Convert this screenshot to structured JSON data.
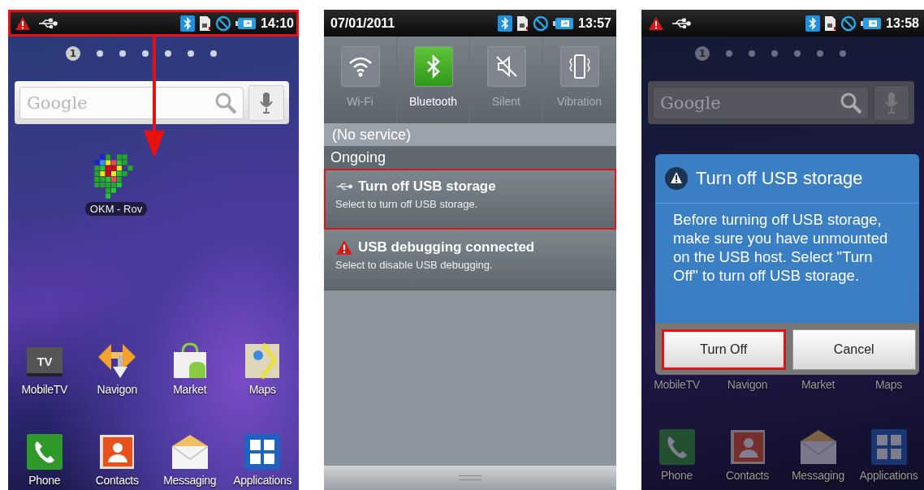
{
  "screens": [
    {
      "kind": "home",
      "status_bar": {
        "time": "14:10",
        "highlighted": true
      },
      "pull_down_arrow": true,
      "page_dots": [
        {
          "label": "1",
          "selected": true
        },
        {
          "selected": false
        },
        {
          "selected": false
        },
        {
          "selected": false
        },
        {
          "selected": false
        },
        {
          "selected": false
        },
        {
          "selected": false
        }
      ],
      "search": {
        "placeholder": "Google"
      },
      "shortcut": {
        "label": "OKM - Rov"
      },
      "apps": [
        {
          "kind": "tv",
          "label": "MobileTV",
          "icon_text": "TV"
        },
        {
          "kind": "navigation",
          "label": "Navigon"
        },
        {
          "kind": "market",
          "label": "Market"
        },
        {
          "kind": "maps",
          "label": "Maps"
        }
      ],
      "dock": [
        {
          "kind": "phone",
          "label": "Phone"
        },
        {
          "kind": "contacts",
          "label": "Contacts"
        },
        {
          "kind": "messaging",
          "label": "Messaging"
        },
        {
          "kind": "grid",
          "label": "Applications"
        }
      ]
    },
    {
      "kind": "notifications",
      "status_bar": {
        "date": "07/01/2011",
        "time": "13:57",
        "highlighted": false
      },
      "toggles": [
        {
          "kind": "wifi",
          "label": "Wi-Fi",
          "on": false
        },
        {
          "kind": "bluetooth",
          "label": "Bluetooth",
          "on": true
        },
        {
          "kind": "silent",
          "label": "Silent",
          "on": false
        },
        {
          "kind": "vibration",
          "label": "Vibration",
          "on": false
        }
      ],
      "carrier": "(No service)",
      "section": "Ongoing",
      "notifications": [
        {
          "kind": "usb",
          "title": "Turn off USB storage",
          "text": "Select to turn off USB storage.",
          "highlighted": true
        },
        {
          "kind": "warning",
          "title": "USB debugging connected",
          "text": "Select to disable USB debugging.",
          "highlighted": false
        }
      ]
    },
    {
      "kind": "dialog",
      "status_bar": {
        "time": "13:58",
        "highlighted": false
      },
      "page_dots": [
        {
          "label": "1",
          "selected": true
        },
        {
          "selected": false
        },
        {
          "selected": false
        },
        {
          "selected": false
        },
        {
          "selected": false
        },
        {
          "selected": false
        },
        {
          "selected": false
        }
      ],
      "search": {
        "placeholder": "Google"
      },
      "dialog": {
        "title": "Turn off USB storage",
        "message": "Before turning off USB storage, make sure you have unmounted on the USB host. Select \"Turn Off\" to turn off USB storage.",
        "buttons": [
          {
            "label": "Turn Off",
            "highlighted": true
          },
          {
            "label": "Cancel",
            "highlighted": false
          }
        ]
      },
      "app_labels": [
        "MobileTV",
        "Navigon",
        "Market",
        "Maps"
      ],
      "dock": [
        {
          "kind": "phone",
          "label": "Phone"
        },
        {
          "kind": "contacts",
          "label": "Contacts"
        },
        {
          "kind": "messaging",
          "label": "Messaging"
        },
        {
          "kind": "grid",
          "label": "Applications"
        }
      ]
    }
  ]
}
